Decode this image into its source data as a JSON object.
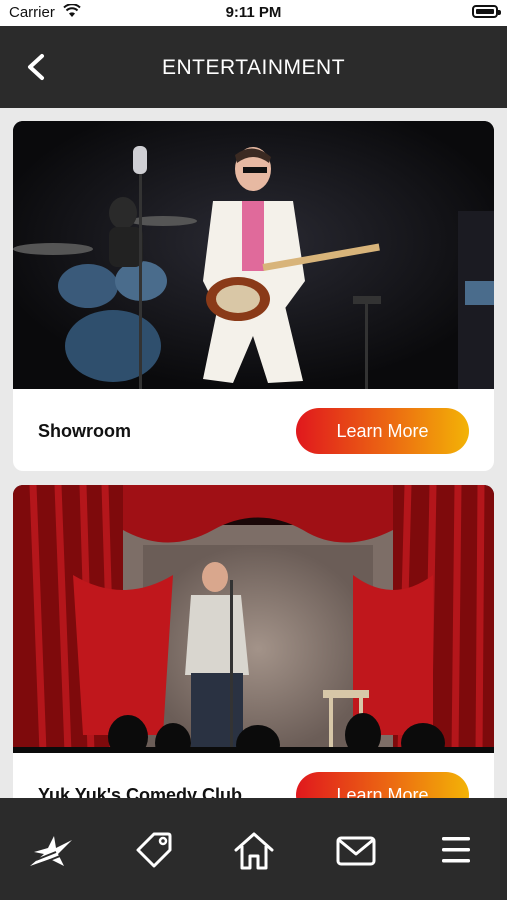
{
  "status_bar": {
    "carrier": "Carrier",
    "time": "9:11 PM"
  },
  "header": {
    "title": "ENTERTAINMENT"
  },
  "venues": [
    {
      "name": "Showroom",
      "button_label": "Learn More"
    },
    {
      "name": "Yuk Yuk's Comedy Club",
      "button_label": "Learn More"
    }
  ],
  "tabbar": {
    "icons": [
      "star-logo-icon",
      "tag-icon",
      "home-icon",
      "mail-icon",
      "menu-icon"
    ]
  },
  "colors": {
    "header_bg": "#2b2b2b",
    "button_gradient": [
      "#e0181d",
      "#ec6a12",
      "#f3b306"
    ],
    "page_bg": "#e9e9e9"
  }
}
